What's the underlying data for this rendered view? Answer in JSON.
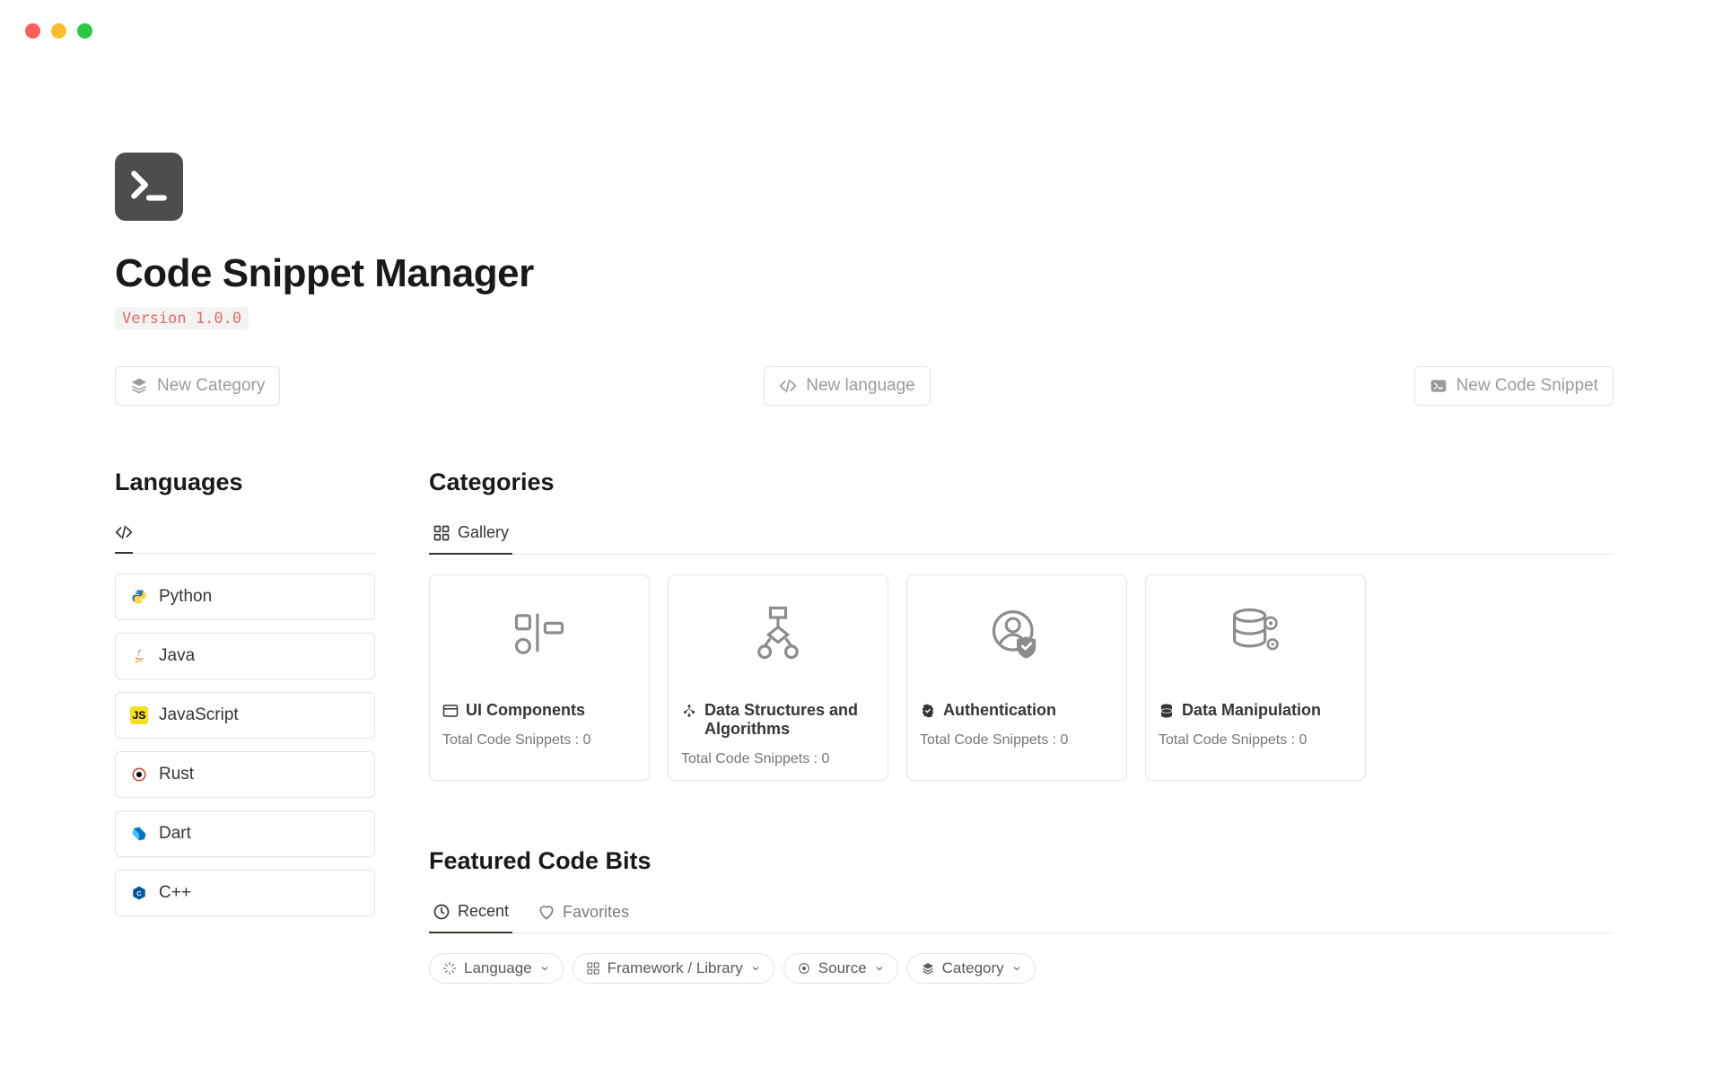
{
  "header": {
    "title": "Code Snippet Manager",
    "version": "Version 1.0.0"
  },
  "actions": {
    "new_category": "New Category",
    "new_language": "New language",
    "new_snippet": "New Code Snippet"
  },
  "languages": {
    "title": "Languages",
    "items": [
      {
        "name": "Python",
        "icon": "python"
      },
      {
        "name": "Java",
        "icon": "java"
      },
      {
        "name": "JavaScript",
        "icon": "javascript"
      },
      {
        "name": "Rust",
        "icon": "rust"
      },
      {
        "name": "Dart",
        "icon": "dart"
      },
      {
        "name": "C++",
        "icon": "cpp"
      }
    ]
  },
  "categories": {
    "title": "Categories",
    "tab_label": "Gallery",
    "snippets_prefix": "Total Code Snippets : ",
    "cards": [
      {
        "title": "UI Components",
        "count": 0,
        "icon": "ui-components"
      },
      {
        "title": "Data Structures and Algorithms",
        "count": 0,
        "icon": "dsa"
      },
      {
        "title": "Authentication",
        "count": 0,
        "icon": "auth"
      },
      {
        "title": "Data Manipulation",
        "count": 0,
        "icon": "data-manip"
      }
    ]
  },
  "featured": {
    "title": "Featured Code Bits",
    "tabs": {
      "recent": "Recent",
      "favorites": "Favorites"
    },
    "filters": {
      "language": "Language",
      "framework": "Framework / Library",
      "source": "Source",
      "category": "Category"
    }
  }
}
